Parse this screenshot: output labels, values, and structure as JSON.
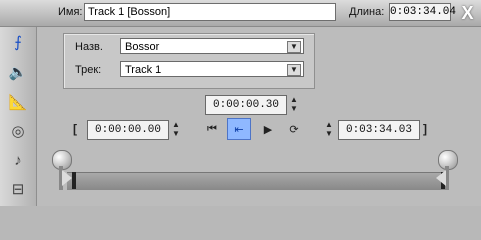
{
  "header": {
    "name_label": "Имя:",
    "name_value": "Track 1 [Bosson]",
    "duration_label": "Длина:",
    "duration_value": "0:03:34.04",
    "close_label": "X"
  },
  "sidebar": {
    "tools": [
      {
        "icon": "waveform-icon",
        "symbol": "⨍"
      },
      {
        "icon": "speaker-icon",
        "symbol": "🔈"
      },
      {
        "icon": "ruler-icon",
        "symbol": "📐"
      },
      {
        "icon": "cd-icon",
        "symbol": "◎"
      },
      {
        "icon": "music-note-icon",
        "symbol": "♪"
      },
      {
        "icon": "plug-icon",
        "symbol": "⊟"
      }
    ]
  },
  "fields": {
    "name_label": "Назв.",
    "name_value": "Bossor",
    "track_label": "Трек:",
    "track_value": "Track 1"
  },
  "controls": {
    "position_value": "0:00:00.30",
    "start_value": "0:00:00.00",
    "end_value": "0:03:34.03",
    "left_bracket": "[",
    "right_bracket": "]",
    "transport": {
      "skip_back": "⏮",
      "prev_mark": "⇤",
      "play": "▶",
      "loop": "⟳"
    }
  }
}
